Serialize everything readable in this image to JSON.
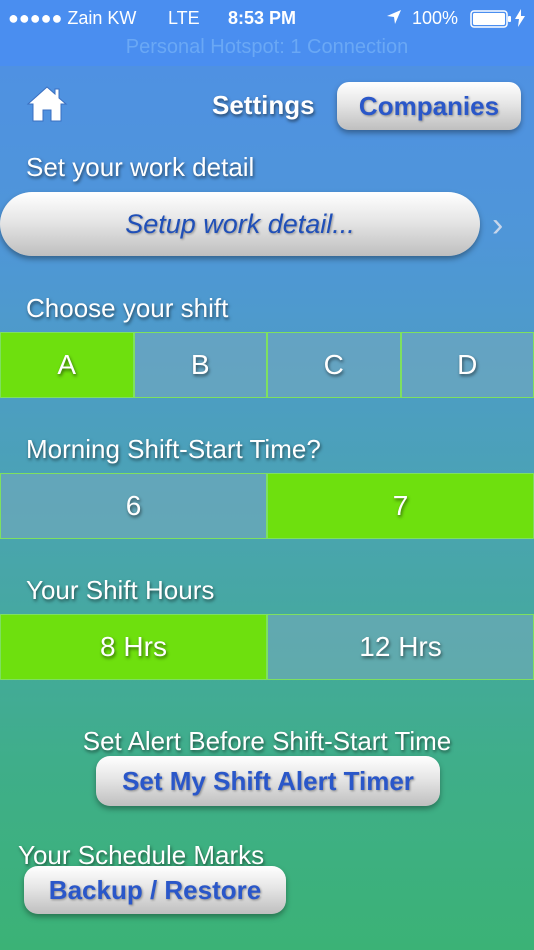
{
  "status_bar": {
    "carrier": "●●●●● Zain KW",
    "network": "LTE",
    "time": "8:53 PM",
    "battery": "100%",
    "hotspot": "Personal Hotspot: 1 Connection"
  },
  "nav": {
    "title": "Settings",
    "companies_label": "Companies"
  },
  "work_detail": {
    "label": "Set your work detail",
    "button": "Setup work detail...",
    "chevron": "›"
  },
  "shift": {
    "label": "Choose your shift",
    "options": [
      "A",
      "B",
      "C",
      "D"
    ],
    "selected": "A"
  },
  "morning_start": {
    "label": "Morning Shift-Start Time?",
    "options": [
      "6",
      "7"
    ],
    "selected": "7"
  },
  "hours": {
    "label": "Your Shift Hours",
    "options": [
      "8 Hrs",
      "12 Hrs"
    ],
    "selected": "8 Hrs"
  },
  "alert": {
    "label": "Set Alert Before Shift-Start Time",
    "button": "Set My Shift Alert Timer"
  },
  "marks": {
    "label": "Your Schedule Marks",
    "button": "Backup / Restore"
  },
  "colors": {
    "selected_segment": "#6ee00e",
    "button_text": "#2a57c9"
  },
  "icons": {
    "home": "home-icon",
    "location": "location-arrow-icon",
    "battery": "battery-icon",
    "charging": "charging-bolt-icon",
    "chevron": "chevron-right-icon"
  }
}
